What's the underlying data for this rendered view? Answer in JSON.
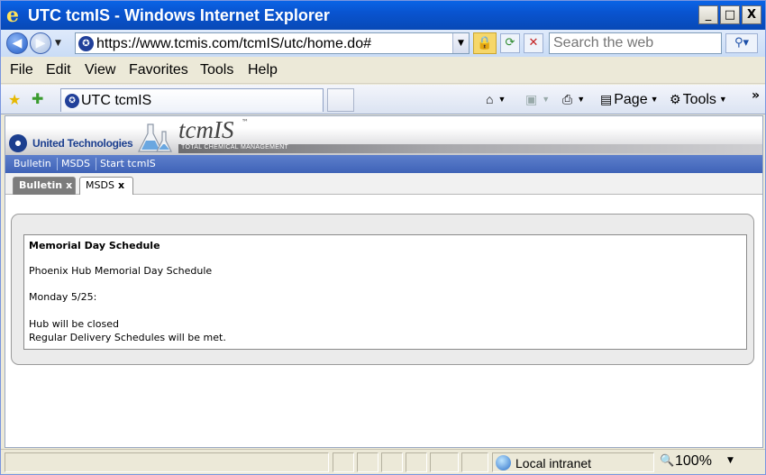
{
  "window": {
    "title": "UTC tcmIS - Windows Internet Explorer",
    "minimize_glyph": "_",
    "maximize_glyph": "□",
    "close_glyph": "X"
  },
  "address_bar": {
    "url": "https://www.tcmis.com/tcmIS/utc/home.do#",
    "search_placeholder": "Search the web"
  },
  "menu": {
    "items": [
      "File",
      "Edit",
      "View",
      "Favorites",
      "Tools",
      "Help"
    ]
  },
  "tab_bar": {
    "tab_title": "UTC tcmIS",
    "commands": {
      "page": "Page",
      "tools": "Tools"
    }
  },
  "page": {
    "banner": {
      "company": "United Technologies",
      "brand": "tcmIS",
      "brand_mark": "™",
      "tagline": "TOTAL CHEMICAL MANAGEMENT"
    },
    "nav_links": [
      "Bulletin",
      "MSDS",
      "Start tcmIS"
    ],
    "sub_tabs": [
      {
        "label": "Bulletin",
        "close": "x"
      },
      {
        "label": "MSDS",
        "close": "x"
      }
    ],
    "bulletin": {
      "title": "Memorial Day Schedule",
      "lines": [
        "Phoenix Hub Memorial Day Schedule",
        "Monday 5/25:",
        "Hub will be closed",
        "Regular Delivery Schedules will be met."
      ]
    }
  },
  "status_bar": {
    "zone": "Local intranet",
    "zoom": "100%"
  },
  "colors": {
    "title_bar": "#0954d0",
    "nav_bar": "#4a6dbf",
    "active_subtab": "#7c7c7c"
  }
}
